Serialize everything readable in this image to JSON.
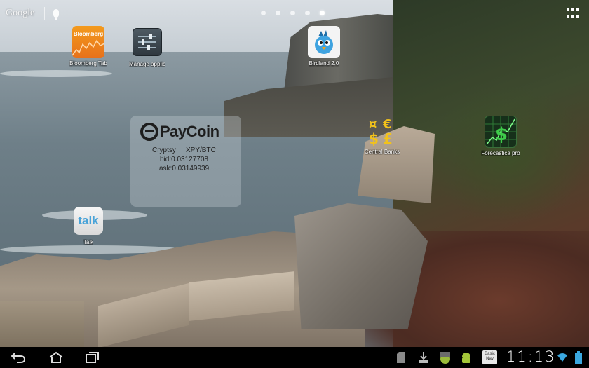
{
  "top_bar": {
    "search_label": "Google",
    "page_count": 5,
    "active_page": 5
  },
  "shortcuts": [
    {
      "label": "Bloomberg Tab",
      "icon": "bloomberg-icon",
      "icon_text": "Bloomberg"
    },
    {
      "label": "Manage applic",
      "icon": "settings-sliders-icon"
    },
    {
      "label": "Birdland 2.0",
      "icon": "bird-icon"
    },
    {
      "label": "Central Banks",
      "icon": "currency-symbols-icon"
    },
    {
      "label": "Forecastica pro",
      "icon": "dollar-chart-icon"
    },
    {
      "label": "Talk",
      "icon": "talk-icon",
      "icon_text": "talk"
    }
  ],
  "paycoin_widget": {
    "brand": "PayCoin",
    "exchange": "Cryptsy",
    "pair": "XPY/BTC",
    "bid": "bid:0.03127708",
    "ask": "ask:0.03149939"
  },
  "navbar": {
    "clock": "11:13",
    "basic_icon_text": "Basic Nav"
  },
  "colors": {
    "bloomberg": "#e7711b",
    "talk_text": "#49a3d8",
    "forecast_green": "#3ecb4a",
    "banks_gold": "#f2c21b"
  }
}
